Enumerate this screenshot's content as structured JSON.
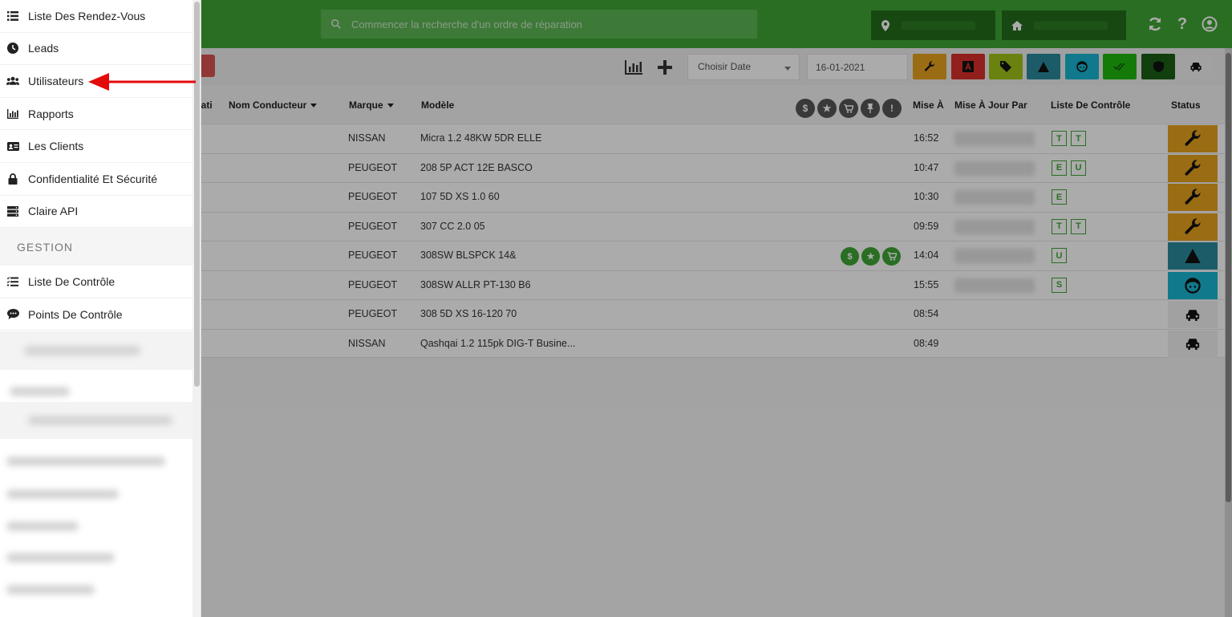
{
  "header": {
    "search_placeholder": "Commencer la recherche d'un ordre de réparation"
  },
  "toolbar": {
    "date_select": "Choisir Date",
    "date_value": "16-01-2021",
    "filter_colors": [
      "#e6a11e",
      "#d9312b",
      "#9ec419",
      "#2a8a9c",
      "#19b5d1",
      "#1fb80c",
      "#1a5e14",
      "#f0f0f0"
    ]
  },
  "table": {
    "headers": {
      "immat": "ulati",
      "driver": "Nom Conducteur",
      "brand": "Marque",
      "model": "Modèle",
      "updated_at": "Mise À",
      "updated_by": "Mise À Jour Par",
      "checklist": "Liste De Contrôle",
      "status": "Status"
    },
    "rows": [
      {
        "brand": "NISSAN",
        "model": "Micra 1.2 48KW 5DR ELLE",
        "time": "16:52",
        "checks": [
          "T",
          "T"
        ],
        "status": "wrench"
      },
      {
        "brand": "PEUGEOT",
        "model": "208 5P ACT 12E BASCO",
        "time": "10:47",
        "checks": [
          "E",
          "U"
        ],
        "status": "wrench"
      },
      {
        "brand": "PEUGEOT",
        "model": "107 5D XS 1.0 60",
        "time": "10:30",
        "checks": [
          "E"
        ],
        "status": "wrench"
      },
      {
        "brand": "PEUGEOT",
        "model": "307 CC 2.0 05",
        "time": "09:59",
        "checks": [
          "T",
          "T"
        ],
        "status": "wrench"
      },
      {
        "brand": "PEUGEOT",
        "model": "308SW BLSPCK 14&",
        "time": "14:04",
        "checks": [
          "U"
        ],
        "status": "warning"
      },
      {
        "brand": "PEUGEOT",
        "model": "308SW ALLR PT-130 B6",
        "time": "15:55",
        "checks": [
          "S"
        ],
        "status": "face"
      },
      {
        "brand": "PEUGEOT",
        "model": "308 5D XS 16-120 70",
        "time": "08:54",
        "checks": [],
        "status": "car"
      },
      {
        "brand": "NISSAN",
        "model": "Qashqai 1.2 115pk DIG-T Busine...",
        "time": "08:49",
        "checks": [],
        "status": "car"
      }
    ]
  },
  "sidebar": {
    "items": [
      {
        "label": "Liste Des Rendez-Vous",
        "icon": "list-icon"
      },
      {
        "label": "Leads",
        "icon": "clock-icon"
      },
      {
        "label": "Utilisateurs",
        "icon": "users-icon"
      },
      {
        "label": "Rapports",
        "icon": "bar-chart-icon"
      },
      {
        "label": "Les Clients",
        "icon": "id-card-icon"
      },
      {
        "label": "Confidentialité Et Sécurité",
        "icon": "lock-icon"
      },
      {
        "label": "Claire API",
        "icon": "server-icon"
      }
    ],
    "section": "GESTION",
    "items2": [
      {
        "label": "Liste De Contrôle",
        "icon": "checklist-icon"
      },
      {
        "label": "Points De Contrôle",
        "icon": "comment-icon"
      }
    ]
  }
}
